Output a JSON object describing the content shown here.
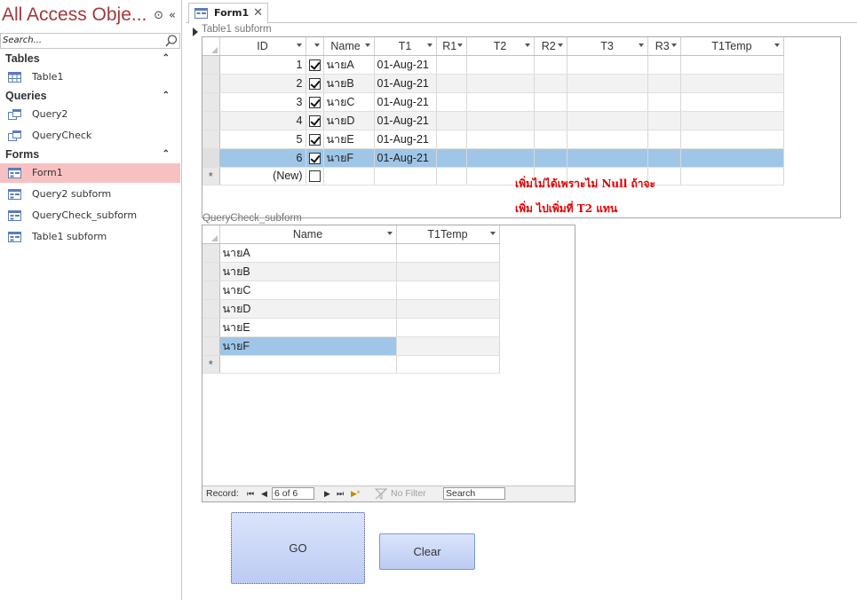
{
  "nav": {
    "title": "All Access Obje...",
    "search_placeholder": "Search...",
    "sections": [
      {
        "label": "Tables",
        "items": [
          {
            "label": "Table1",
            "icon": "table-icon"
          }
        ]
      },
      {
        "label": "Queries",
        "items": [
          {
            "label": "Query2",
            "icon": "query-icon"
          },
          {
            "label": "QueryCheck",
            "icon": "query-icon"
          }
        ]
      },
      {
        "label": "Forms",
        "items": [
          {
            "label": "Form1",
            "icon": "form-icon"
          },
          {
            "label": "Query2 subform",
            "icon": "form-icon"
          },
          {
            "label": "QueryCheck_subform",
            "icon": "form-icon"
          },
          {
            "label": "Table1 subform",
            "icon": "form-icon"
          }
        ]
      }
    ]
  },
  "tab": {
    "label": "Form1",
    "close": "✕"
  },
  "subform1": {
    "label": "Table1 subform",
    "columns": [
      "",
      "ID",
      "",
      "Name",
      "T1",
      "R1",
      "T2",
      "R2",
      "T3",
      "R3",
      "T1Temp"
    ],
    "rows": [
      {
        "id": "1",
        "checked": true,
        "name": "นายA",
        "t1": "01-Aug-21"
      },
      {
        "id": "2",
        "checked": true,
        "name": "นายB",
        "t1": "01-Aug-21"
      },
      {
        "id": "3",
        "checked": true,
        "name": "นายC",
        "t1": "01-Aug-21"
      },
      {
        "id": "4",
        "checked": true,
        "name": "นายD",
        "t1": "01-Aug-21"
      },
      {
        "id": "5",
        "checked": true,
        "name": "นายE",
        "t1": "01-Aug-21"
      },
      {
        "id": "6",
        "checked": true,
        "name": "นายF",
        "t1": "01-Aug-21"
      }
    ],
    "new_row_marker": "*",
    "new_row_id": "(New)"
  },
  "annotation": {
    "line1": "เพิ่มไม่ได้เพราะไม่ Null ถ้าจะ",
    "line2": "เพิ่ม ไปเพิ่มที่ T2 แทน"
  },
  "subform2": {
    "label": "QueryCheck_subform",
    "columns": [
      "",
      "Name",
      "T1Temp"
    ],
    "rows": [
      "นายA",
      "นายB",
      "นายC",
      "นายD",
      "นายE",
      "นายF"
    ],
    "new_row_marker": "*",
    "navbar": {
      "record_label": "Record:",
      "first": "⏮",
      "prev": "◀",
      "position": "6 of 6",
      "next": "▶",
      "last": "⏭",
      "new": "▶*",
      "filter_label": "No Filter",
      "search_label": "Search"
    }
  },
  "buttons": {
    "go": "GO",
    "clear": "Clear"
  },
  "colors": {
    "accent": "#a4373a",
    "selected_row": "#9fc6e7",
    "active_nav": "#f8c1c1",
    "annotation": "#e00000"
  }
}
